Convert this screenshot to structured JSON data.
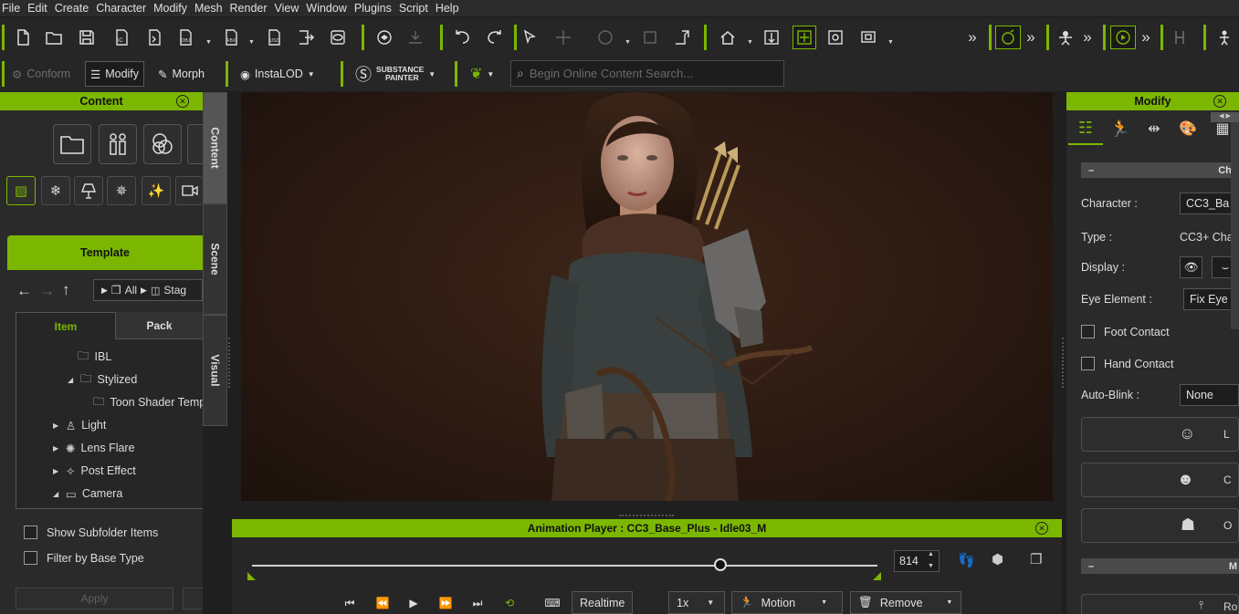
{
  "menu": [
    "File",
    "Edit",
    "Create",
    "Character",
    "Modify",
    "Mesh",
    "Render",
    "View",
    "Window",
    "Plugins",
    "Script",
    "Help"
  ],
  "toolbar2": {
    "conform": "Conform",
    "modify": "Modify",
    "morph": "Morph",
    "instalod": "InstaLOD",
    "substance_top": "SUBSTANCE",
    "substance_bottom": "PAINTER",
    "search_placeholder": "Begin Online Content Search..."
  },
  "content_panel": {
    "title": "Content",
    "template_tab": "Template",
    "path_all": "All",
    "path_stage": "Stag",
    "item_tab": "Item",
    "pack_tab": "Pack",
    "tree": [
      {
        "label": "IBL",
        "indent": 2,
        "expander": "",
        "icon": "folder"
      },
      {
        "label": "Stylized",
        "indent": 1,
        "expander": "open",
        "icon": "folder"
      },
      {
        "label": "Toon Shader Temp",
        "indent": 3,
        "expander": "",
        "icon": "folder"
      },
      {
        "label": "Light",
        "indent": 0,
        "expander": "closed",
        "icon": "light"
      },
      {
        "label": "Lens Flare",
        "indent": 0,
        "expander": "closed",
        "icon": "flare"
      },
      {
        "label": "Post Effect",
        "indent": 0,
        "expander": "closed",
        "icon": "fx"
      },
      {
        "label": "Camera",
        "indent": 0,
        "expander": "open",
        "icon": "camera"
      }
    ],
    "show_subfolder": "Show Subfolder Items",
    "filter_base": "Filter by Base Type",
    "apply": "Apply"
  },
  "side_tabs": [
    "Content",
    "Scene",
    "Visual"
  ],
  "animation_player": {
    "title": "Animation Player : CC3_Base_Plus - Idle03_M",
    "frame": "814",
    "realtime": "Realtime",
    "speed": "1x",
    "motion": "Motion",
    "remove": "Remove",
    "progress": 0.75
  },
  "modify_panel": {
    "title": "Modify",
    "section_label": "Cha",
    "character_label": "Character :",
    "character_value": "CC3_Ba",
    "type_label": "Type :",
    "type_value": "CC3+ Cha",
    "display_label": "Display :",
    "eye_label": "Eye Element :",
    "eye_value": "Fix Eye",
    "foot_contact": "Foot Contact",
    "hand_contact": "Hand Contact",
    "autoblink_label": "Auto-Blink :",
    "autoblink_value": "None",
    "btn1": "L",
    "btn2": "C",
    "btn3": "O",
    "section2": "M",
    "btn4": "Ro"
  },
  "colors": {
    "accent": "#7bb700",
    "bg": "#262626"
  }
}
